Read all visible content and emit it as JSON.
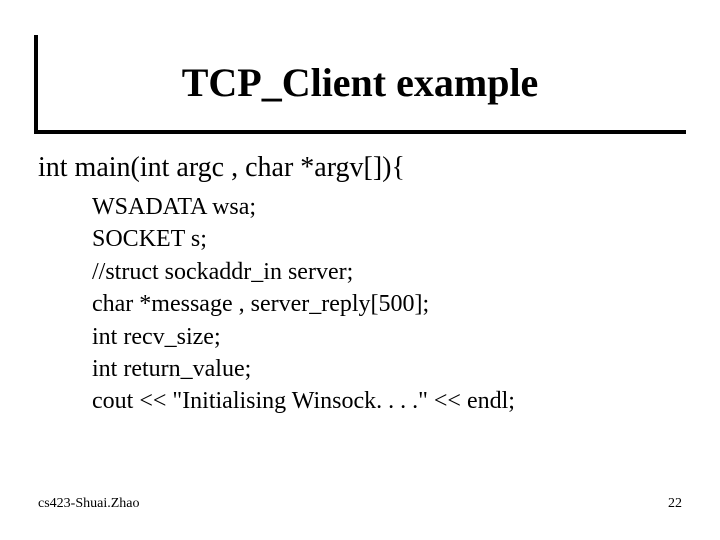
{
  "title": "TCP_Client example",
  "code": {
    "signature": "int main(int argc , char *argv[]){",
    "lines": [
      "WSADATA wsa;",
      "SOCKET s;",
      "//struct sockaddr_in server;",
      "char *message , server_reply[500];",
      "int recv_size;",
      "int return_value;",
      "cout << \"Initialising Winsock. . . .\" << endl;"
    ]
  },
  "footer": {
    "left": "cs423-Shuai.Zhao",
    "right": "22"
  }
}
